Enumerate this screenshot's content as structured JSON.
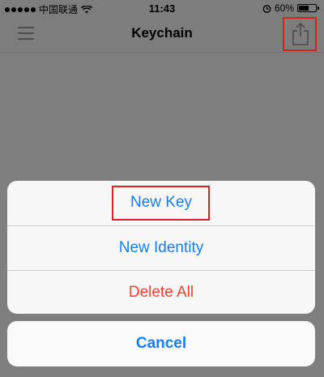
{
  "status_bar": {
    "carrier": "中国联通",
    "time": "11:43",
    "battery": "60%",
    "battery_level": 0.6,
    "icons": [
      "signal-dots-icon",
      "wifi-icon",
      "alarm-icon",
      "battery-icon"
    ]
  },
  "nav": {
    "title": "Keychain",
    "left_icon": "menu-icon",
    "right_icon": "share-icon"
  },
  "action_sheet": {
    "items": [
      {
        "label": "New Key"
      },
      {
        "label": "New Identity"
      },
      {
        "label": "Delete All"
      }
    ],
    "cancel": "Cancel"
  },
  "colors": {
    "accent": "#147efb",
    "destructive": "#ff3b30",
    "annotation": "#e02020"
  }
}
